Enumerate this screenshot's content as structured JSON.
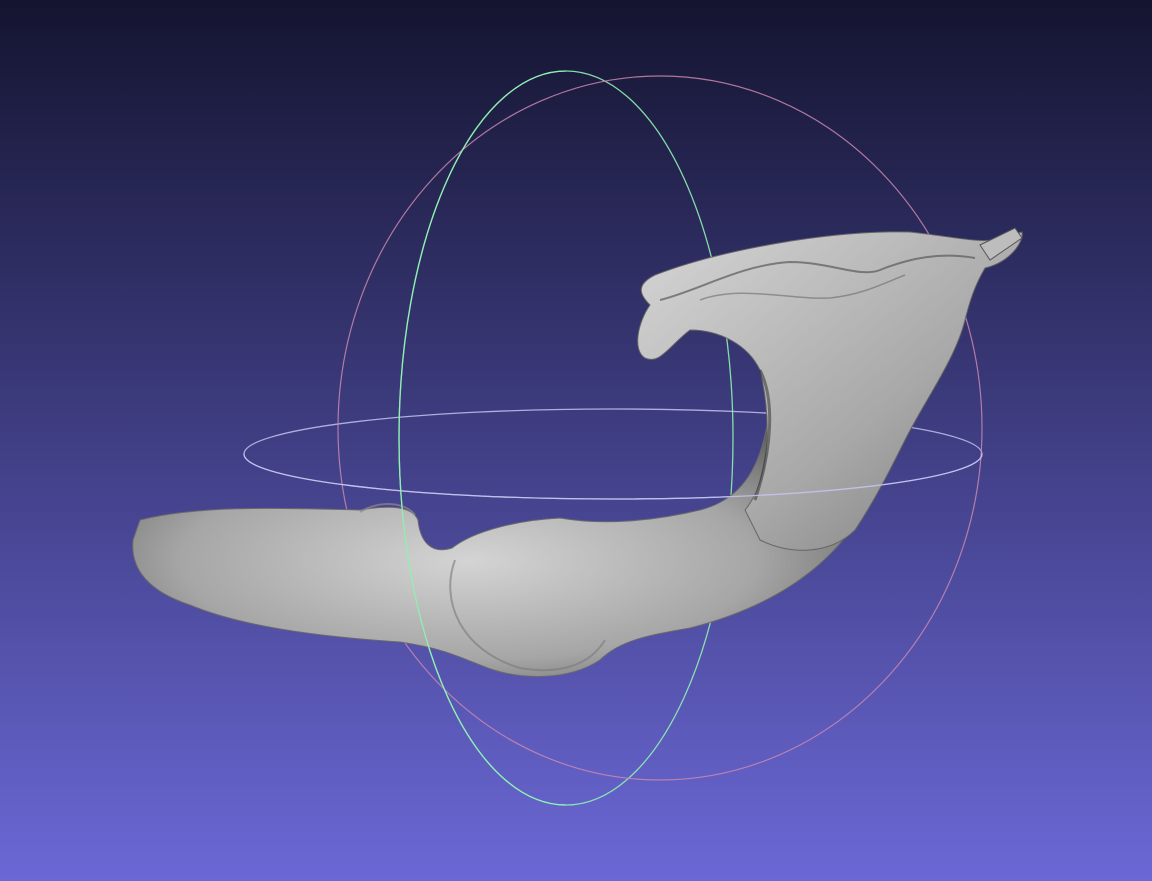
{
  "viewport": {
    "background_top_color": "#141430",
    "background_bottom_color": "#6b68d6",
    "mesh_color": "#a6a6a6",
    "mesh_highlight_color": "#d4d4d4",
    "mesh_shadow_color": "#4c4c4c"
  },
  "trackball": {
    "x_axis_ring_color": "#c987b0",
    "y_axis_ring_color": "#8ff0b2",
    "z_axis_ring_color": "#c3c3ef"
  }
}
